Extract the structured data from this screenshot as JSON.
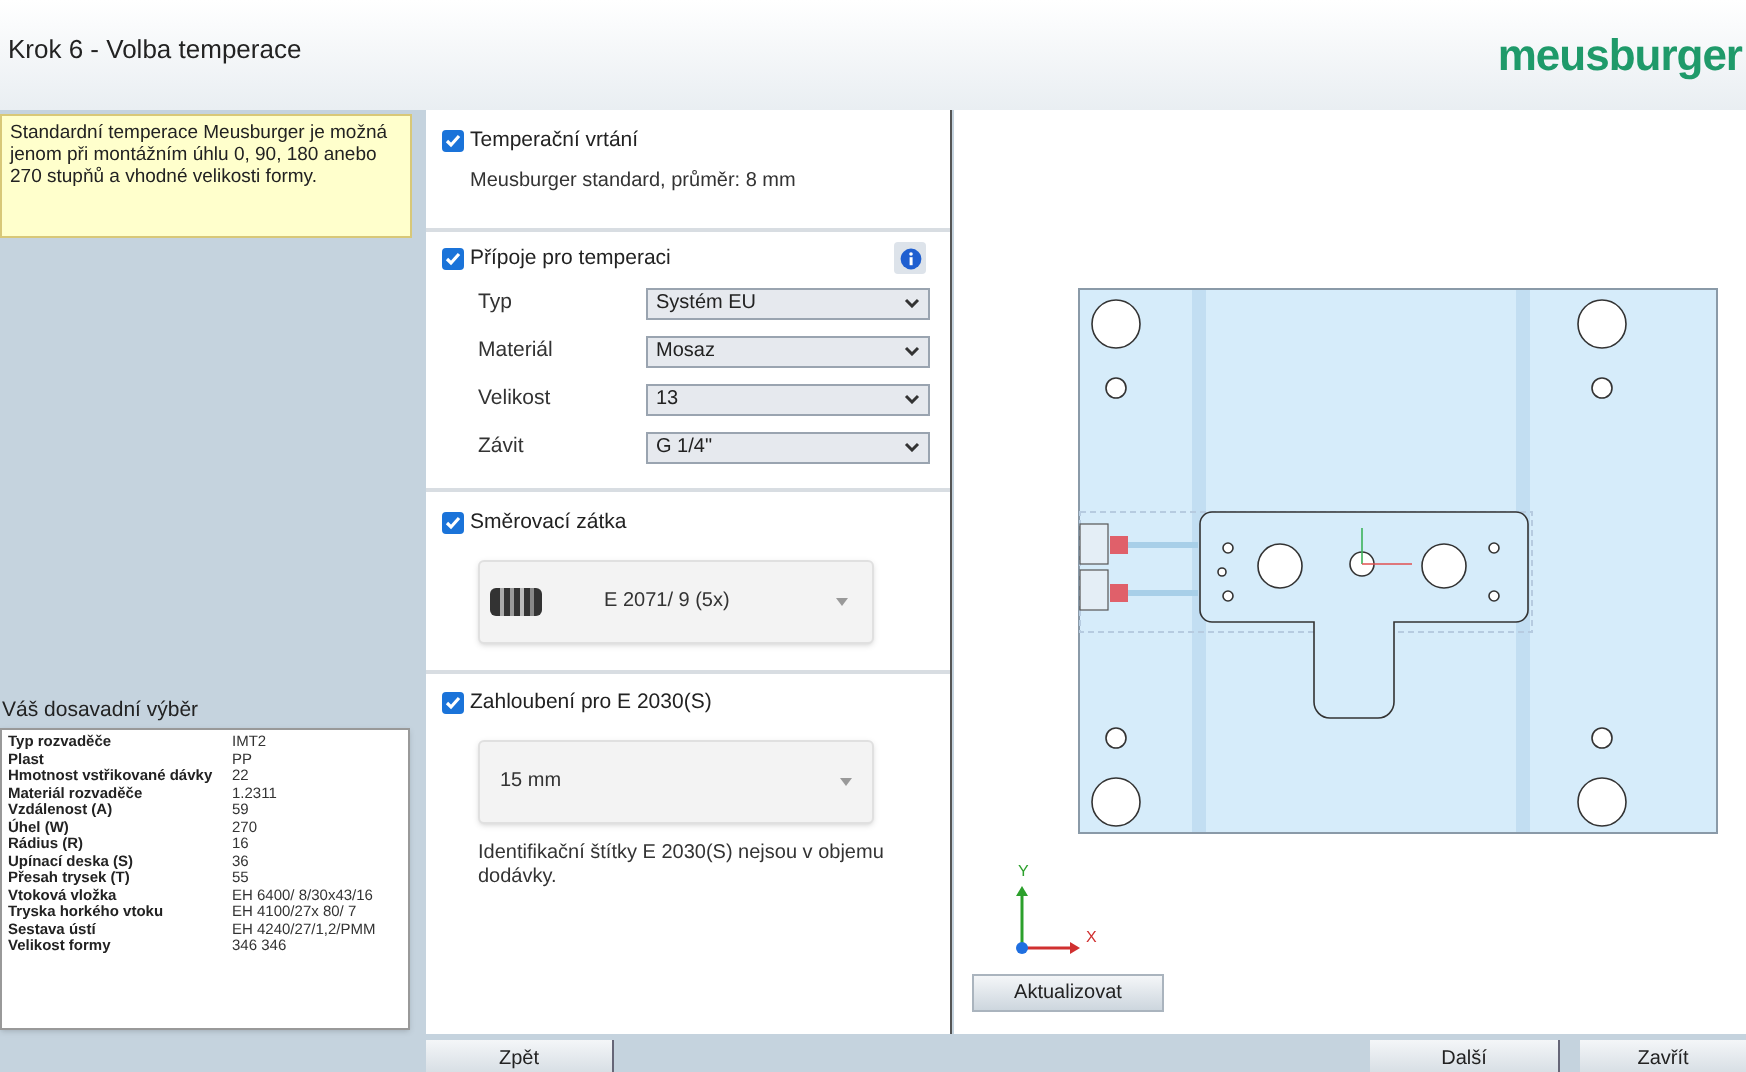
{
  "window": {
    "title": "Krok 6 - Volba temperace",
    "logo": "meusburger"
  },
  "hint": "Standardní temperace Meusburger je možná jenom při montážním úhlu 0, 90, 180 anebo 270 stupňů a vhodné velikosti formy.",
  "summary": {
    "title": "Váš dosavadní výběr",
    "rows": [
      {
        "label": "Typ rozvaděče",
        "value": "IMT2"
      },
      {
        "label": "Plast",
        "value": "PP"
      },
      {
        "label": "Hmotnost vstřikované dávky",
        "value": "22"
      },
      {
        "label": "Materiál rozvaděče",
        "value": "1.2311"
      },
      {
        "label": "Vzdálenost (A)",
        "value": "59"
      },
      {
        "label": "Úhel (W)",
        "value": "270"
      },
      {
        "label": "Rádius (R)",
        "value": "16"
      },
      {
        "label": "Upínací deska (S)",
        "value": "36"
      },
      {
        "label": "Přesah trysek (T)",
        "value": "55"
      },
      {
        "label": "Vtoková vložka",
        "value": "EH 6400/ 8/30x43/16"
      },
      {
        "label": "Tryska horkého vtoku",
        "value": "EH 4100/27x 80/ 7"
      },
      {
        "label": "Sestava ústí",
        "value": "EH 4240/27/1,2/PMM"
      },
      {
        "label": "Velikost formy",
        "value": "346 346"
      }
    ]
  },
  "sections": [
    {
      "kind": "text",
      "label": "Temperační vrtání",
      "checked": true,
      "text": "Meusburger standard, průměr: 8 mm"
    },
    {
      "kind": "fields",
      "label": "Přípoje pro temperaci",
      "checked": true,
      "fields": [
        {
          "label": "Typ",
          "value": "Systém EU"
        },
        {
          "label": "Materiál",
          "value": "Mosaz"
        },
        {
          "label": "Velikost",
          "value": "13"
        },
        {
          "label": "Závit",
          "value": "G 1/4\""
        }
      ]
    },
    {
      "kind": "picker",
      "label": "Směrovací zátka",
      "checked": true,
      "value": "E 2071/ 9 (5x)"
    },
    {
      "kind": "dropdown",
      "label": "Zahloubení pro E 2030(S)",
      "checked": true,
      "value": "15 mm",
      "note": "Identifikační štítky E 2030(S) nejsou v objemu dodávky."
    }
  ],
  "axes": {
    "x": "X",
    "y": "Y"
  },
  "update_button": "Aktualizovat",
  "nav": {
    "back": "Zpět",
    "next": "Další",
    "close": "Zavřít"
  }
}
